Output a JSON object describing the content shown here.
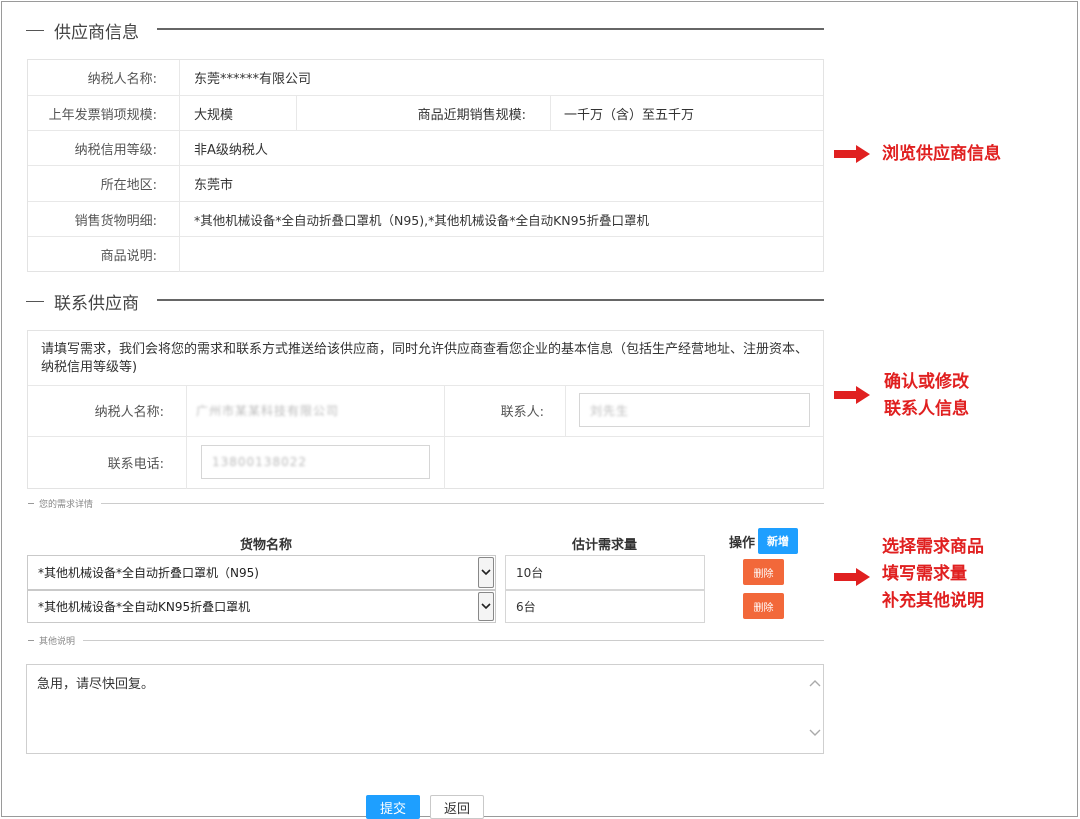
{
  "supplier_section": {
    "title": "供应商信息",
    "rows": [
      {
        "label": "纳税人名称:",
        "value": "东莞******有限公司"
      },
      {
        "label": "上年发票销项规模:",
        "value": "大规模",
        "label2": "商品近期销售规模:",
        "value2": "一千万（含）至五千万"
      },
      {
        "label": "纳税信用等级:",
        "value": "非A级纳税人"
      },
      {
        "label": "所在地区:",
        "value": "东莞市"
      },
      {
        "label": "销售货物明细:",
        "value": "*其他机械设备*全自动折叠口罩机（N95),*其他机械设备*全自动KN95折叠口罩机"
      },
      {
        "label": "商品说明:",
        "value": ""
      }
    ]
  },
  "contact_section": {
    "title": "联系供应商",
    "notice": "请填写需求，我们会将您的需求和联系方式推送给该供应商，同时允许供应商查看您企业的基本信息（包括生产经营地址、注册资本、纳税信用等级等)",
    "taxpayer_label": "纳税人名称:",
    "taxpayer_value": "广州市某某科技有限公司",
    "contact_label": "联系人:",
    "contact_value": "刘先生",
    "phone_label": "联系电话:",
    "phone_value": "13800138022"
  },
  "demand_section": {
    "title": "您的需求详情",
    "col_goods": "货物名称",
    "col_qty": "估计需求量",
    "col_ops": "操作",
    "add_label": "新增",
    "delete_label": "删除",
    "rows": [
      {
        "goods": "*其他机械设备*全自动折叠口罩机（N95)",
        "qty": "10台"
      },
      {
        "goods": "*其他机械设备*全自动KN95折叠口罩机",
        "qty": "6台"
      }
    ]
  },
  "other_section": {
    "title": "其他说明",
    "text": "急用，请尽快回复。"
  },
  "actions": {
    "submit_label": "提交",
    "back_label": "返回"
  },
  "annotations": {
    "browse": "浏览供应商信息",
    "confirm_line1": "确认或修改",
    "confirm_line2": "联系人信息",
    "select_line1": "选择需求商品",
    "select_line2": "填写需求量",
    "select_line3": "补充其他说明"
  },
  "colors": {
    "annotation_red": "#e02020",
    "primary_blue": "#1e9fff",
    "delete_orange": "#f2683a"
  }
}
